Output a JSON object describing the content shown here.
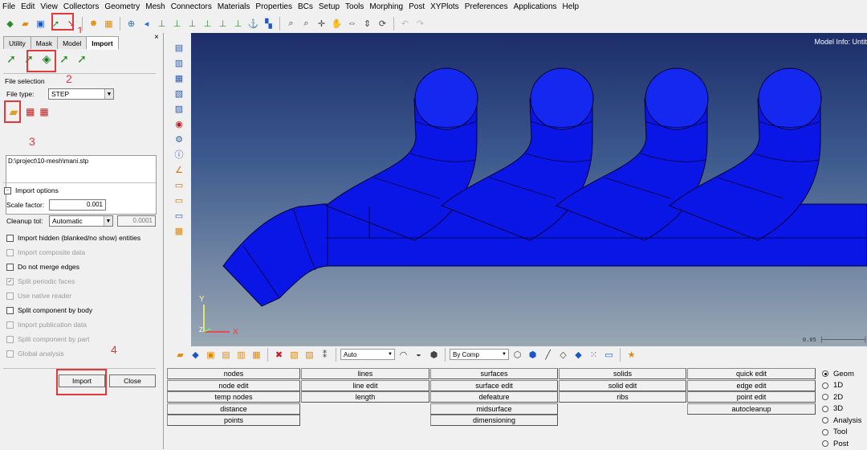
{
  "menubar": [
    "File",
    "Edit",
    "View",
    "Collectors",
    "Geometry",
    "Mesh",
    "Connectors",
    "Materials",
    "Properties",
    "BCs",
    "Setup",
    "Tools",
    "Morphing",
    "Post",
    "XYPlots",
    "Preferences",
    "Applications",
    "Help"
  ],
  "annotations": {
    "n1": "1",
    "n2": "2",
    "n3": "3",
    "n4": "4"
  },
  "panel": {
    "tabs": [
      "Utility",
      "Mask",
      "Model",
      "Import"
    ],
    "active_tab": "Import",
    "close": "×",
    "file_selection_label": "File selection",
    "file_type_label": "File type:",
    "file_type_value": "STEP",
    "file_path": "D:\\project\\10-mesh\\mani.stp",
    "import_options_label": "Import options",
    "scale_factor_label": "Scale factor:",
    "scale_factor_value": "0.001",
    "cleanup_tol_label": "Cleanup tol:",
    "cleanup_tol_mode": "Automatic",
    "cleanup_tol_value": "0.0001",
    "options": [
      {
        "label": "Import hidden (blanked/no show) entities",
        "checked": false,
        "disabled": false
      },
      {
        "label": "Import composite data",
        "checked": false,
        "disabled": true
      },
      {
        "label": "Do not merge edges",
        "checked": false,
        "disabled": false
      },
      {
        "label": "Split periodic faces",
        "checked": true,
        "disabled": true
      },
      {
        "label": "Use native reader",
        "checked": false,
        "disabled": true
      },
      {
        "label": "Split component by body",
        "checked": false,
        "disabled": false
      },
      {
        "label": "Import publication data",
        "checked": false,
        "disabled": true
      },
      {
        "label": "Split component by part",
        "checked": false,
        "disabled": true
      },
      {
        "label": "Global analysis",
        "checked": false,
        "disabled": true
      }
    ],
    "import_button": "Import",
    "close_button": "Close"
  },
  "graphics": {
    "model_info": "Model Info: Untit",
    "scale_value": "0.05",
    "axis_x": "X",
    "axis_y": "Y",
    "axis_z": "Z",
    "model_color": "#0a16e6",
    "edge_color": "#000033"
  },
  "bottom_toolbar": {
    "auto_label": "Auto",
    "bycomp_label": "By Comp"
  },
  "menu": {
    "col1": [
      "nodes",
      "node edit",
      "temp nodes",
      "distance",
      "points"
    ],
    "col2": [
      "lines",
      "line edit",
      "length"
    ],
    "col3": [
      "surfaces",
      "surface edit",
      "defeature",
      "midsurface",
      "dimensioning"
    ],
    "col4": [
      "solids",
      "solid edit",
      "ribs"
    ],
    "col5": [
      "quick edit",
      "edge edit",
      "point edit",
      "autocleanup"
    ]
  },
  "page_radios": [
    {
      "label": "Geom",
      "selected": true
    },
    {
      "label": "1D",
      "selected": false
    },
    {
      "label": "2D",
      "selected": false
    },
    {
      "label": "3D",
      "selected": false
    },
    {
      "label": "Analysis",
      "selected": false
    },
    {
      "label": "Tool",
      "selected": false
    },
    {
      "label": "Post",
      "selected": false
    }
  ]
}
